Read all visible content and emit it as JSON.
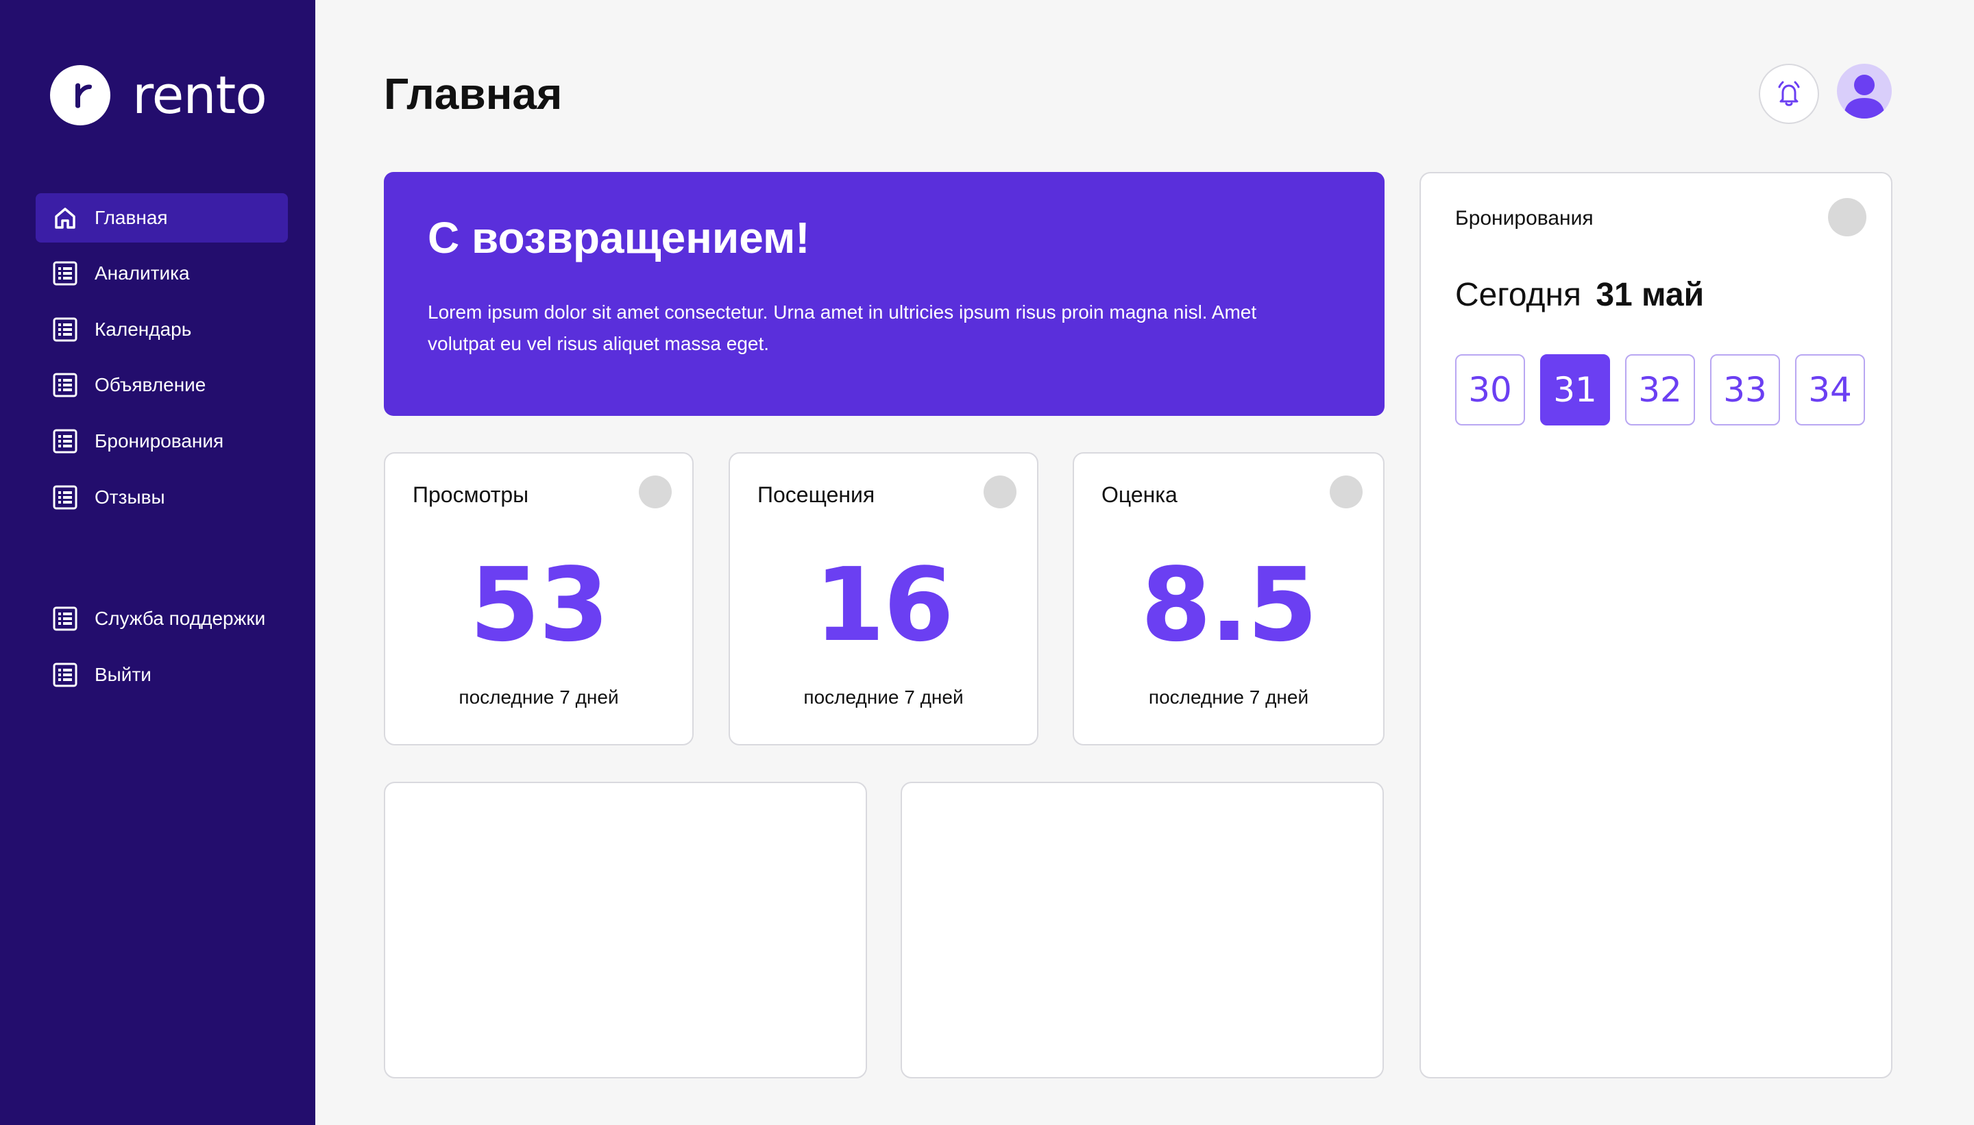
{
  "brand": {
    "name": "rento"
  },
  "sidebar": {
    "items": [
      {
        "label": "Главная",
        "icon": "home-icon"
      },
      {
        "label": "Аналитика",
        "icon": "list-icon"
      },
      {
        "label": "Календарь",
        "icon": "list-icon"
      },
      {
        "label": "Объявление",
        "icon": "list-icon"
      },
      {
        "label": "Бронирования",
        "icon": "list-icon"
      },
      {
        "label": "Отзывы",
        "icon": "list-icon"
      }
    ],
    "footer_items": [
      {
        "label": "Служба поддержки",
        "icon": "list-icon"
      },
      {
        "label": "Выйти",
        "icon": "list-icon"
      }
    ],
    "active": "Главная"
  },
  "header": {
    "title": "Главная",
    "bell_icon": "bell-icon",
    "avatar_icon": "user-icon"
  },
  "welcome": {
    "title": "С возвращением!",
    "text": "Lorem ipsum dolor sit amet consectetur. Urna amet in ultricies ipsum risus proin magna nisl. Amet volutpat eu vel risus aliquet massa eget."
  },
  "stats": [
    {
      "label": "Просмотры",
      "value": "53",
      "period": "последние 7 дней"
    },
    {
      "label": "Посещения",
      "value": "16",
      "period": "последние 7 дней"
    },
    {
      "label": "Оценка",
      "value": "8.5",
      "period": "последние 7 дней"
    }
  ],
  "bookings": {
    "title": "Бронирования",
    "today_label": "Сегодня",
    "today_date": "31 май",
    "days": [
      "30",
      "31",
      "32",
      "33",
      "34"
    ],
    "selected_day": "31"
  },
  "colors": {
    "sidebar_bg": "#230d6d",
    "sidebar_active": "#3b1ea6",
    "accent": "#6b3ff2",
    "welcome_bg": "#5a2fdb",
    "page_bg": "#f6f6f6"
  }
}
